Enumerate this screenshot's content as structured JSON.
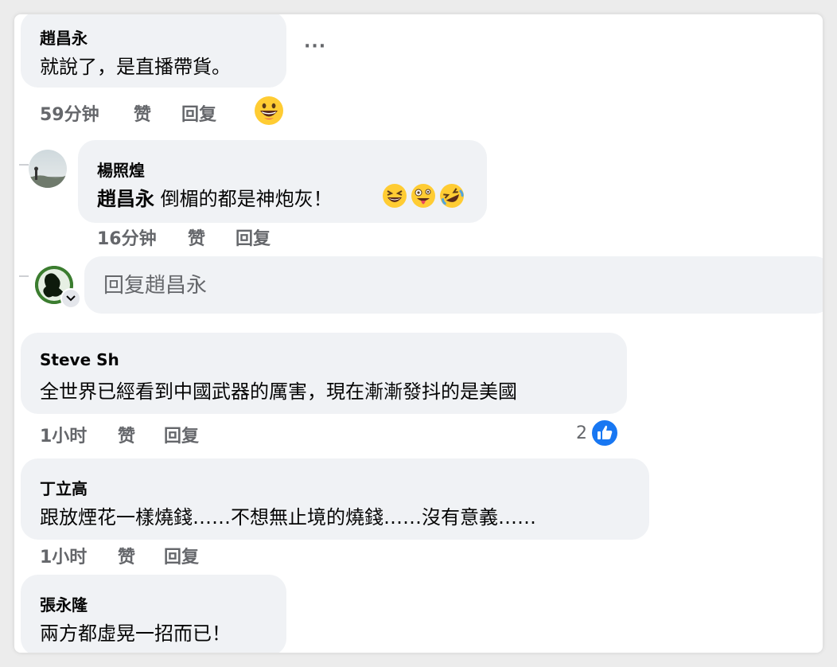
{
  "comments": [
    {
      "author": "趙昌永",
      "text": "就說了，是直播帶貨。",
      "time": "59分钟",
      "like": "赞",
      "reply": "回复",
      "reaction_icon": "grinning-face-icon"
    },
    {
      "author": "楊照煌",
      "mention": "趙昌永",
      "text": " 倒楣的都是神炮灰！",
      "time": "16分钟",
      "like": "赞",
      "reply": "回复",
      "emojis": [
        "laughing-face-icon",
        "zany-face-icon",
        "rolling-laughing-icon"
      ]
    },
    {
      "author": "Steve Sh",
      "text": "全世界已經看到中國武器的厲害，現在漸漸發抖的是美國",
      "time": "1小时",
      "like": "赞",
      "reply": "回复",
      "like_count": "2"
    },
    {
      "author": "丁立高",
      "text": "跟放煙花一樣燒錢……不想無止境的燒錢……沒有意義……",
      "time": "1小时",
      "like": "赞",
      "reply": "回复"
    },
    {
      "author": "張永隆",
      "text": "兩方都虛晃一招而已！"
    }
  ],
  "reply_box": {
    "placeholder": "回复趙昌永"
  },
  "more_label": "···",
  "colors": {
    "bubble": "#f0f2f5",
    "meta": "#65676b",
    "like_blue": "#1877f2"
  }
}
